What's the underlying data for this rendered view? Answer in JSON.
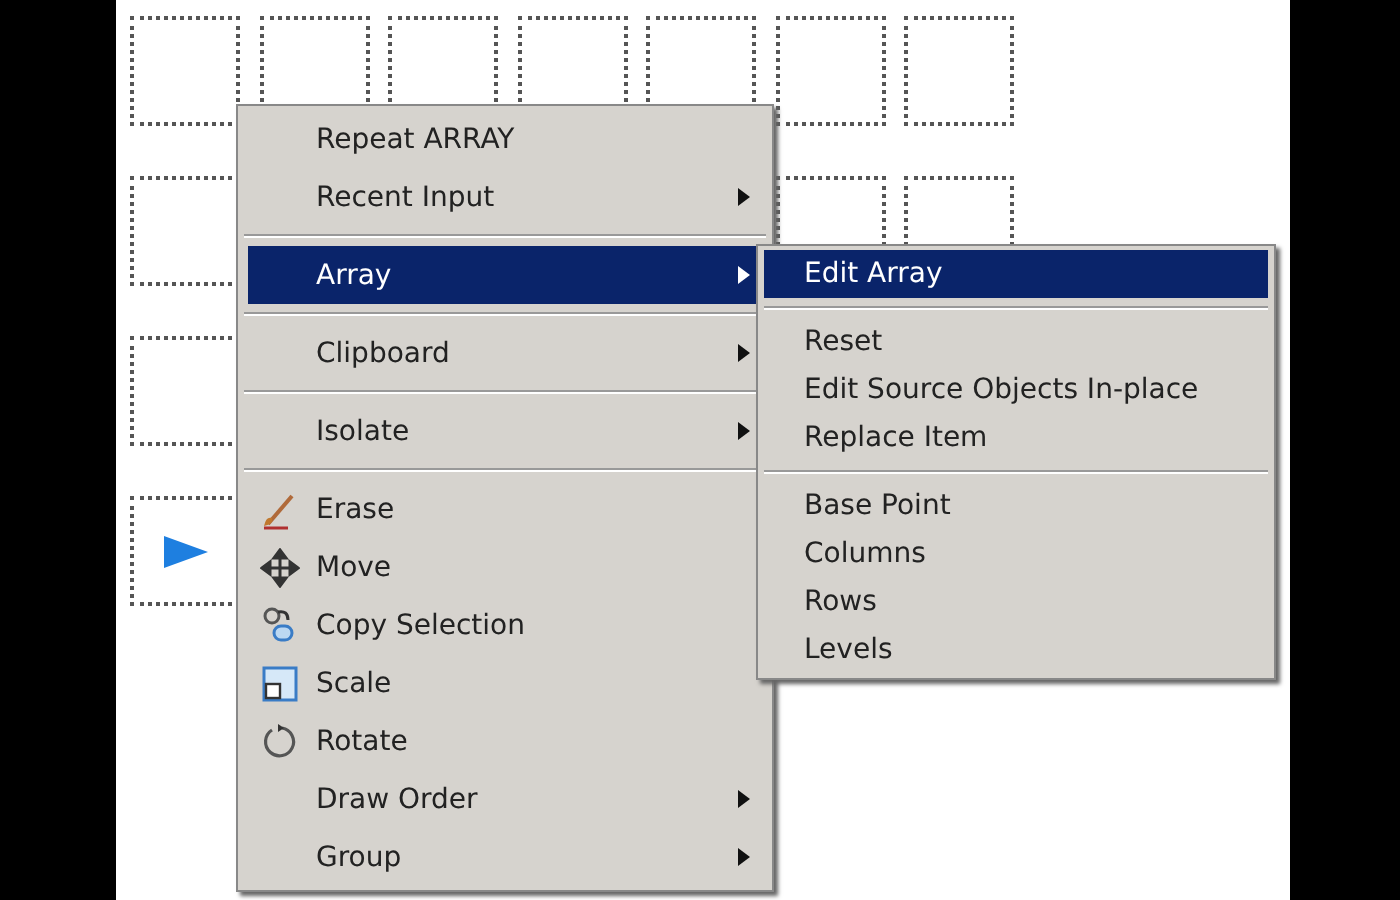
{
  "context_menu": {
    "items": [
      {
        "kind": "item",
        "label": "Repeat ARRAY",
        "submenu": false,
        "selected": false
      },
      {
        "kind": "item",
        "label": "Recent Input",
        "submenu": true,
        "selected": false
      },
      {
        "kind": "separator"
      },
      {
        "kind": "item",
        "label": "Array",
        "submenu": true,
        "selected": true
      },
      {
        "kind": "separator"
      },
      {
        "kind": "item",
        "label": "Clipboard",
        "submenu": true,
        "selected": false
      },
      {
        "kind": "separator"
      },
      {
        "kind": "item",
        "label": "Isolate",
        "submenu": true,
        "selected": false
      },
      {
        "kind": "separator"
      },
      {
        "kind": "item",
        "label": "Erase",
        "submenu": false,
        "selected": false
      },
      {
        "kind": "item",
        "label": "Move",
        "submenu": false,
        "selected": false
      },
      {
        "kind": "item",
        "label": "Copy Selection",
        "submenu": false,
        "selected": false
      },
      {
        "kind": "item",
        "label": "Scale",
        "submenu": false,
        "selected": false
      },
      {
        "kind": "item",
        "label": "Rotate",
        "submenu": false,
        "selected": false
      },
      {
        "kind": "item",
        "label": "Draw Order",
        "submenu": true,
        "selected": false
      },
      {
        "kind": "item",
        "label": "Group",
        "submenu": true,
        "selected": false
      }
    ]
  },
  "submenu": {
    "items": [
      {
        "kind": "item",
        "label": "Edit Array",
        "selected": true
      },
      {
        "kind": "separator"
      },
      {
        "kind": "item",
        "label": "Reset",
        "selected": false
      },
      {
        "kind": "item",
        "label": "Edit Source Objects In-place",
        "selected": false
      },
      {
        "kind": "item",
        "label": "Replace Item",
        "selected": false
      },
      {
        "kind": "separator"
      },
      {
        "kind": "item",
        "label": "Base Point",
        "selected": false
      },
      {
        "kind": "item",
        "label": "Columns",
        "selected": false
      },
      {
        "kind": "item",
        "label": "Rows",
        "selected": false
      },
      {
        "kind": "item",
        "label": "Levels",
        "selected": false
      }
    ]
  }
}
